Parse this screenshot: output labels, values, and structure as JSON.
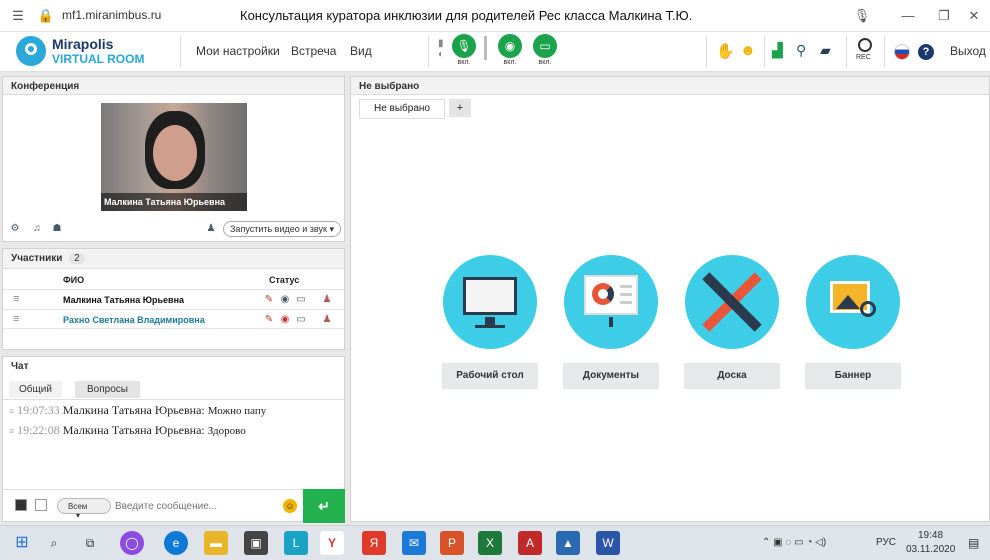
{
  "browser": {
    "url": "mf1.miranimbus.ru",
    "title": "Консультация куратора инклюзии для родителей Рес класса Малкина Т.Ю."
  },
  "header": {
    "logo_line1": "Mirapolis",
    "logo_line2": "VIRTUAL ROOM",
    "menu": [
      "Мои настройки",
      "Встреча",
      "Вид"
    ],
    "mic_label": "вкл.",
    "cam_label": "вкл.",
    "screen_label": "вкл.",
    "rec_label": "REC",
    "exit_label": "Выход"
  },
  "conference": {
    "title": "Конференция",
    "video_name": "Малкина Татьяна  Юрьевна",
    "start_av": "Запустить видео и звук"
  },
  "participants": {
    "title": "Участники",
    "count": "2",
    "col_name": "ФИО",
    "col_status": "Статус",
    "rows": [
      {
        "name": "Малкина Татьяна  Юрьевна"
      },
      {
        "name": "Рахно Светлана  Владимировна"
      }
    ]
  },
  "chat": {
    "title": "Чат",
    "tabs": [
      "Общий",
      "Вопросы"
    ],
    "messages": [
      {
        "time": "19:07:33",
        "author": "Малкина Татьяна  Юрьевна:",
        "text": "Можно  папу"
      },
      {
        "time": "19:22:08",
        "author": "Малкина Татьяна  Юрьевна:",
        "text": "Здорово"
      }
    ],
    "recipient": "Всем",
    "placeholder": "Введите сообщение..."
  },
  "workspace": {
    "title": "Не выбрано",
    "tab": "Не выбрано",
    "add_tab": "+",
    "features": [
      "Рабочий стол",
      "Документы",
      "Доска",
      "Баннер"
    ]
  },
  "taskbar": {
    "lang": "РУС",
    "time": "19:48",
    "date": "03.11.2020"
  },
  "colors": {
    "accent_green": "#1aa34a",
    "feature_cyan": "#3ecde6",
    "send_green": "#22b14c"
  }
}
